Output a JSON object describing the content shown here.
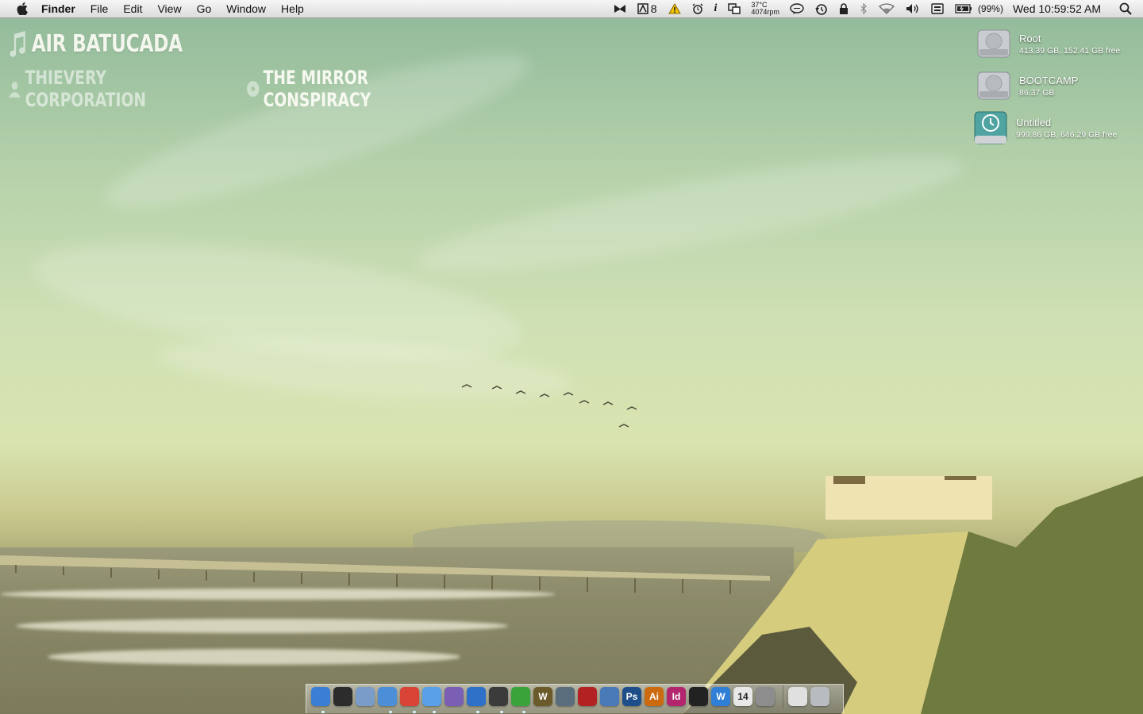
{
  "menubar": {
    "app_name": "Finder",
    "items": [
      "File",
      "Edit",
      "View",
      "Go",
      "Window",
      "Help"
    ],
    "status": {
      "notification_count": "8",
      "temperature": "37°C",
      "fan_speed": "4074rpm",
      "battery_percent": "(99%)",
      "clock": "Wed 10:59:52 AM"
    },
    "icons": [
      "apple-icon",
      "growl-icon",
      "adobe-updater-icon",
      "warning-icon",
      "alarm-clock-icon",
      "info-icon",
      "screen-sharing-icon",
      "chat-icon",
      "time-machine-icon",
      "lock-icon",
      "bluetooth-icon",
      "wifi-icon",
      "volume-icon",
      "keyboard-icon",
      "battery-icon",
      "spotlight-icon"
    ]
  },
  "now_playing": {
    "track": "AIR BATUCADA",
    "artist": "THIEVERY CORPORATION",
    "album": "THE MIRROR CONSPIRACY"
  },
  "drives": [
    {
      "name": "Root",
      "info": "413.39 GB, 152.41 GB free",
      "icon": "hard-drive-icon"
    },
    {
      "name": "BOOTCAMP",
      "info": "86.37 GB",
      "icon": "hard-drive-icon"
    },
    {
      "name": "Untitled",
      "info": "999.86 GB, 646.29 GB free",
      "icon": "time-machine-drive-icon"
    }
  ],
  "dock": {
    "apps": [
      {
        "name": "finder-icon",
        "label": "",
        "color": "#3a7fd5"
      },
      {
        "name": "dashboard-icon",
        "label": "",
        "color": "#2c2c2c"
      },
      {
        "name": "mail-icon",
        "label": "",
        "color": "#7a9cc8"
      },
      {
        "name": "safari-icon",
        "label": "",
        "color": "#4c8fd8"
      },
      {
        "name": "chrome-icon",
        "label": "",
        "color": "#d94437"
      },
      {
        "name": "ichat-icon",
        "label": "",
        "color": "#5aa0e8"
      },
      {
        "name": "itunes-icon",
        "label": "",
        "color": "#7b5fb5"
      },
      {
        "name": "itunes-blue-icon",
        "label": "",
        "color": "#2f70c9"
      },
      {
        "name": "steam-icon",
        "label": "",
        "color": "#3b3b3b"
      },
      {
        "name": "utorrent-icon",
        "label": "",
        "color": "#3aa43a"
      },
      {
        "name": "wow-icon",
        "label": "W",
        "color": "#6b5a2a"
      },
      {
        "name": "globe-icon",
        "label": "",
        "color": "#5a6d7c"
      },
      {
        "name": "acrobat-icon",
        "label": "",
        "color": "#b22222"
      },
      {
        "name": "xcode-icon",
        "label": "",
        "color": "#4a79b8"
      },
      {
        "name": "photoshop-icon",
        "label": "Ps",
        "color": "#1e4e8a"
      },
      {
        "name": "illustrator-icon",
        "label": "Ai",
        "color": "#cc6a10"
      },
      {
        "name": "indesign-icon",
        "label": "Id",
        "color": "#b3266e"
      },
      {
        "name": "aperture-icon",
        "label": "",
        "color": "#222222"
      },
      {
        "name": "word-icon",
        "label": "W",
        "color": "#2f7fd6"
      },
      {
        "name": "calendar-icon",
        "label": "14",
        "color": "#e8e8e8"
      },
      {
        "name": "system-preferences-icon",
        "label": "",
        "color": "#8d8d8d"
      }
    ],
    "right": [
      {
        "name": "downloads-stack-icon",
        "label": "",
        "color": "#e0e0e0"
      },
      {
        "name": "trash-icon",
        "label": "",
        "color": "#b8bcc0"
      }
    ]
  }
}
